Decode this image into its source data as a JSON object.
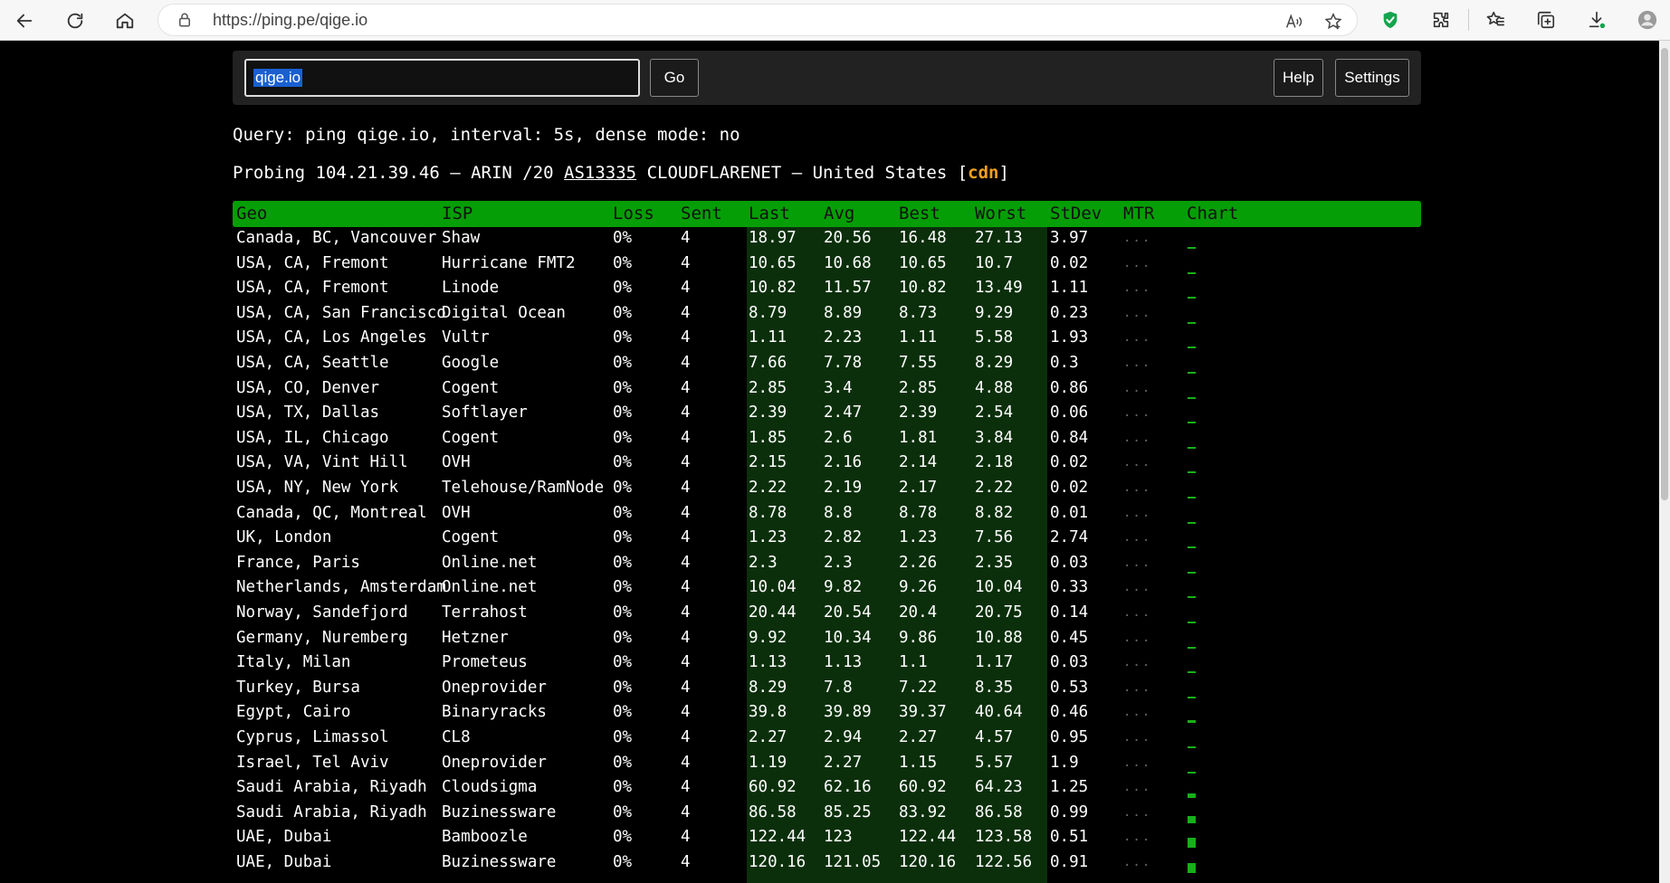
{
  "browser": {
    "url": "https://ping.pe/qige.io"
  },
  "search": {
    "value": "qige.io",
    "go_label": "Go",
    "help_label": "Help",
    "settings_label": "Settings"
  },
  "query_line": "Query: ping qige.io, interval: 5s, dense mode: no",
  "probe": {
    "prefix": "Probing 104.21.39.46 — ARIN /20 ",
    "asn": "AS13335",
    "middle": " CLOUDFLARENET — United States [",
    "tag": "cdn",
    "suffix": "]"
  },
  "table": {
    "headers": [
      "Geo",
      "ISP",
      "Loss",
      "Sent",
      "Last",
      "Avg",
      "Best",
      "Worst",
      "StDev",
      "MTR",
      "Chart"
    ],
    "mtr_placeholder": "...",
    "rows": [
      {
        "geo": "Canada, BC, Vancouver",
        "isp": "Shaw",
        "loss": "0%",
        "sent": "4",
        "last": "18.97",
        "avg": "20.56",
        "best": "16.48",
        "worst": "27.13",
        "stdev": "3.97"
      },
      {
        "geo": "USA, CA, Fremont",
        "isp": "Hurricane FMT2",
        "loss": "0%",
        "sent": "4",
        "last": "10.65",
        "avg": "10.68",
        "best": "10.65",
        "worst": "10.7",
        "stdev": "0.02"
      },
      {
        "geo": "USA, CA, Fremont",
        "isp": "Linode",
        "loss": "0%",
        "sent": "4",
        "last": "10.82",
        "avg": "11.57",
        "best": "10.82",
        "worst": "13.49",
        "stdev": "1.11"
      },
      {
        "geo": "USA, CA, San Francisco",
        "isp": "Digital Ocean",
        "loss": "0%",
        "sent": "4",
        "last": "8.79",
        "avg": "8.89",
        "best": "8.73",
        "worst": "9.29",
        "stdev": "0.23"
      },
      {
        "geo": "USA, CA, Los Angeles",
        "isp": "Vultr",
        "loss": "0%",
        "sent": "4",
        "last": "1.11",
        "avg": "2.23",
        "best": "1.11",
        "worst": "5.58",
        "stdev": "1.93"
      },
      {
        "geo": "USA, CA, Seattle",
        "isp": "Google",
        "loss": "0%",
        "sent": "4",
        "last": "7.66",
        "avg": "7.78",
        "best": "7.55",
        "worst": "8.29",
        "stdev": "0.3"
      },
      {
        "geo": "USA, CO, Denver",
        "isp": "Cogent",
        "loss": "0%",
        "sent": "4",
        "last": "2.85",
        "avg": "3.4",
        "best": "2.85",
        "worst": "4.88",
        "stdev": "0.86"
      },
      {
        "geo": "USA, TX, Dallas",
        "isp": "Softlayer",
        "loss": "0%",
        "sent": "4",
        "last": "2.39",
        "avg": "2.47",
        "best": "2.39",
        "worst": "2.54",
        "stdev": "0.06"
      },
      {
        "geo": "USA, IL, Chicago",
        "isp": "Cogent",
        "loss": "0%",
        "sent": "4",
        "last": "1.85",
        "avg": "2.6",
        "best": "1.81",
        "worst": "3.84",
        "stdev": "0.84"
      },
      {
        "geo": "USA, VA, Vint Hill",
        "isp": "OVH",
        "loss": "0%",
        "sent": "4",
        "last": "2.15",
        "avg": "2.16",
        "best": "2.14",
        "worst": "2.18",
        "stdev": "0.02"
      },
      {
        "geo": "USA, NY, New York",
        "isp": "Telehouse/RamNode",
        "loss": "0%",
        "sent": "4",
        "last": "2.22",
        "avg": "2.19",
        "best": "2.17",
        "worst": "2.22",
        "stdev": "0.02"
      },
      {
        "geo": "Canada, QC, Montreal",
        "isp": "OVH",
        "loss": "0%",
        "sent": "4",
        "last": "8.78",
        "avg": "8.8",
        "best": "8.78",
        "worst": "8.82",
        "stdev": "0.01"
      },
      {
        "geo": "UK, London",
        "isp": "Cogent",
        "loss": "0%",
        "sent": "4",
        "last": "1.23",
        "avg": "2.82",
        "best": "1.23",
        "worst": "7.56",
        "stdev": "2.74"
      },
      {
        "geo": "France, Paris",
        "isp": "Online.net",
        "loss": "0%",
        "sent": "4",
        "last": "2.3",
        "avg": "2.3",
        "best": "2.26",
        "worst": "2.35",
        "stdev": "0.03"
      },
      {
        "geo": "Netherlands, Amsterdam",
        "isp": "Online.net",
        "loss": "0%",
        "sent": "4",
        "last": "10.04",
        "avg": "9.82",
        "best": "9.26",
        "worst": "10.04",
        "stdev": "0.33"
      },
      {
        "geo": "Norway, Sandefjord",
        "isp": "Terrahost",
        "loss": "0%",
        "sent": "4",
        "last": "20.44",
        "avg": "20.54",
        "best": "20.4",
        "worst": "20.75",
        "stdev": "0.14"
      },
      {
        "geo": "Germany, Nuremberg",
        "isp": "Hetzner",
        "loss": "0%",
        "sent": "4",
        "last": "9.92",
        "avg": "10.34",
        "best": "9.86",
        "worst": "10.88",
        "stdev": "0.45"
      },
      {
        "geo": "Italy, Milan",
        "isp": "Prometeus",
        "loss": "0%",
        "sent": "4",
        "last": "1.13",
        "avg": "1.13",
        "best": "1.1",
        "worst": "1.17",
        "stdev": "0.03"
      },
      {
        "geo": "Turkey, Bursa",
        "isp": "Oneprovider",
        "loss": "0%",
        "sent": "4",
        "last": "8.29",
        "avg": "7.8",
        "best": "7.22",
        "worst": "8.35",
        "stdev": "0.53"
      },
      {
        "geo": "Egypt, Cairo",
        "isp": "Binaryracks",
        "loss": "0%",
        "sent": "4",
        "last": "39.8",
        "avg": "39.89",
        "best": "39.37",
        "worst": "40.64",
        "stdev": "0.46"
      },
      {
        "geo": "Cyprus, Limassol",
        "isp": "CL8",
        "loss": "0%",
        "sent": "4",
        "last": "2.27",
        "avg": "2.94",
        "best": "2.27",
        "worst": "4.57",
        "stdev": "0.95"
      },
      {
        "geo": "Israel, Tel Aviv",
        "isp": "Oneprovider",
        "loss": "0%",
        "sent": "4",
        "last": "1.19",
        "avg": "2.27",
        "best": "1.15",
        "worst": "5.57",
        "stdev": "1.9"
      },
      {
        "geo": "Saudi Arabia, Riyadh",
        "isp": "Cloudsigma",
        "loss": "0%",
        "sent": "4",
        "last": "60.92",
        "avg": "62.16",
        "best": "60.92",
        "worst": "64.23",
        "stdev": "1.25"
      },
      {
        "geo": "Saudi Arabia, Riyadh",
        "isp": "Buzinessware",
        "loss": "0%",
        "sent": "4",
        "last": "86.58",
        "avg": "85.25",
        "best": "83.92",
        "worst": "86.58",
        "stdev": "0.99"
      },
      {
        "geo": "UAE, Dubai",
        "isp": "Bamboozle",
        "loss": "0%",
        "sent": "4",
        "last": "122.44",
        "avg": "123",
        "best": "122.44",
        "worst": "123.58",
        "stdev": "0.51"
      },
      {
        "geo": "UAE, Dubai",
        "isp": "Buzinessware",
        "loss": "0%",
        "sent": "4",
        "last": "120.16",
        "avg": "121.05",
        "best": "120.16",
        "worst": "122.56",
        "stdev": "0.91"
      }
    ]
  },
  "colors": {
    "header_bg": "#069e06",
    "highlight_col": "#0b2f0b",
    "chart_bar": "#18b018",
    "cdn_tag": "#f0a020",
    "selection": "#1a5fd0"
  },
  "icons": [
    "back-icon",
    "reload-icon",
    "home-icon",
    "lock-icon",
    "read-aloud-icon",
    "favorite-add-icon",
    "shield-extension-icon",
    "puzzle-extensions-icon",
    "favorites-icon",
    "collections-icon",
    "downloads-icon",
    "profile-icon"
  ]
}
